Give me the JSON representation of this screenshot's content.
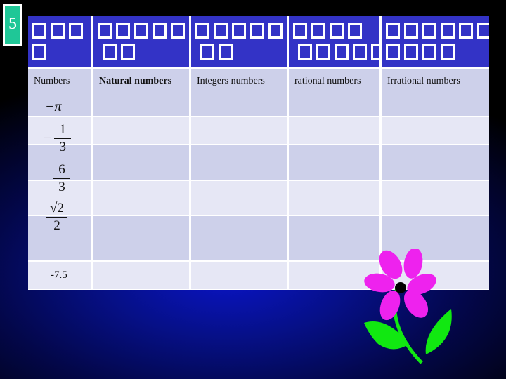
{
  "slide": {
    "number": "5",
    "accent_color": "#1fc797",
    "header_color": "#3333c6"
  },
  "table": {
    "header_glyphs": [
      "missing-glyph-text",
      "missing-glyph-text",
      "missing-glyph-text",
      "missing-glyph-text",
      "missing-glyph-text"
    ],
    "columns": [
      "Numbers",
      "Natural numbers",
      "Integers numbers",
      "rational numbers",
      "Irrational numbers"
    ],
    "rows": [
      {
        "number": "−π",
        "natural": "",
        "integer": "",
        "rational": "",
        "irrational": ""
      },
      {
        "number": "−1/3",
        "sign": "−",
        "numerator": "1",
        "denominator": "3",
        "natural": "",
        "integer": "",
        "rational": "",
        "irrational": ""
      },
      {
        "number": "6/3",
        "numerator": "6",
        "denominator": "3",
        "natural": "",
        "integer": "",
        "rational": "",
        "irrational": ""
      },
      {
        "number": "√2/2",
        "numerator": "√2",
        "denominator": "2",
        "natural": "",
        "integer": "",
        "rational": "",
        "irrational": ""
      },
      {
        "number": "-7.5",
        "natural": "",
        "integer": "",
        "rational": "",
        "irrational": ""
      }
    ]
  },
  "decoration": {
    "flower": "pink-flower-clipart"
  }
}
